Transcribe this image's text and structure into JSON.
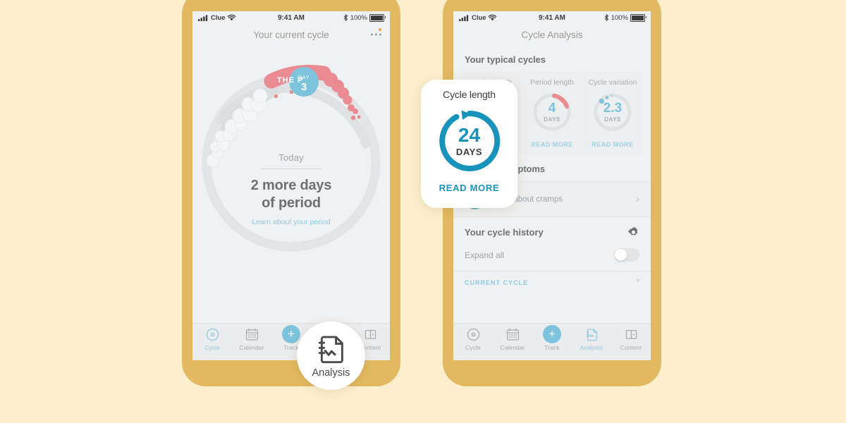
{
  "background_color": "#FDEFCE",
  "phone_frame_color": "#E2B960",
  "accent_teal": "#7EC3DC",
  "accent_teal_dark": "#1793BC",
  "accent_pink": "#E98B91",
  "phones": {
    "left": {
      "status_bar": {
        "carrier": "Clue",
        "time": "9:41 AM",
        "battery": "100%",
        "signal_icon": "cellular-signal-icon",
        "wifi_icon": "wifi-icon",
        "bluetooth_icon": "bluetooth-icon",
        "battery_icon": "battery-icon"
      },
      "nav_title": "Your current cycle",
      "more_icon": "more-options-icon",
      "wheel": {
        "ribbon_label": "THE P",
        "day_badge_top": "DAY",
        "day_badge_num": "3",
        "today_label": "Today",
        "headline_line1": "2 more days",
        "headline_line2": "of period",
        "link": "Learn about your period"
      },
      "tabs": [
        {
          "label": "Cycle",
          "icon": "cycle-icon",
          "active": true
        },
        {
          "label": "Calendar",
          "icon": "calendar-icon",
          "active": false
        },
        {
          "label": "Track",
          "icon": "plus-icon",
          "active": false
        },
        {
          "label": "Analysis",
          "icon": "analysis-document-icon",
          "active": false
        },
        {
          "label": "Content",
          "icon": "book-icon",
          "active": false
        }
      ]
    },
    "right": {
      "status_bar": {
        "carrier": "Clue",
        "time": "9:41 AM",
        "battery": "100%"
      },
      "nav_title": "Cycle Analysis",
      "section_typical": "Your typical cycles",
      "typical_cards": [
        {
          "title": "Cycle length",
          "value": "24",
          "unit": "DAYS",
          "read_more": "READ MORE",
          "ring_color": "#1793BC"
        },
        {
          "title": "Period length",
          "value": "4",
          "unit": "DAYS",
          "read_more": "READ MORE",
          "ring_color": "#E98B91"
        },
        {
          "title": "Cycle variation",
          "value": "2.3",
          "unit": "DAYS",
          "read_more": "READ MORE",
          "ring_color": "#7EC3DC"
        }
      ],
      "section_symptoms": "Current symptoms",
      "symptom_row": {
        "label": "More about cramps",
        "icon": "cramps-icon",
        "chevron": "›"
      },
      "section_history": "Your cycle history",
      "settings_icon": "gear-icon",
      "expand_all_label": "Expand all",
      "expand_all_state": "off",
      "clipped_row_label": "CURRENT CYCLE",
      "tabs": [
        {
          "label": "Cycle",
          "icon": "cycle-icon",
          "active": false
        },
        {
          "label": "Calendar",
          "icon": "calendar-icon",
          "active": false
        },
        {
          "label": "Track",
          "icon": "plus-icon",
          "active": false
        },
        {
          "label": "Analysis",
          "icon": "analysis-document-icon",
          "active": true
        },
        {
          "label": "Content",
          "icon": "book-icon",
          "active": false
        }
      ]
    }
  },
  "magnifiers": {
    "analysis": {
      "label": "Analysis",
      "icon": "analysis-document-icon"
    },
    "cycle_length": {
      "title": "Cycle length",
      "value": "24",
      "unit": "DAYS",
      "read_more": "READ MORE"
    }
  }
}
